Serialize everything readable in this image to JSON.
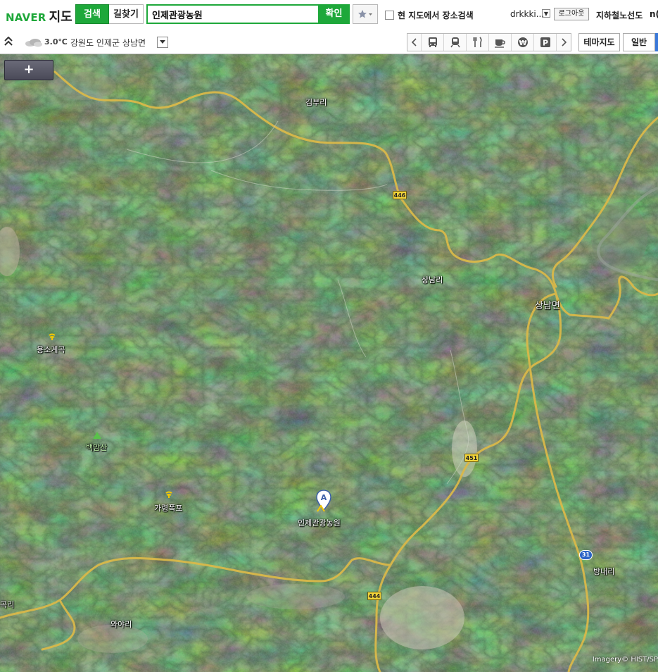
{
  "header": {
    "logo_brand": "NAVER",
    "logo_service": "지도",
    "tab_search": "검색",
    "tab_route": "길찾기",
    "search_value": "인제관광농원",
    "confirm_label": "확인",
    "checkbox_label": "현 지도에서 장소검색",
    "username": "drkkki...",
    "logout_label": "로그아웃",
    "subway_label": "지하철노선도",
    "extra_link": "n("
  },
  "subbar": {
    "temperature": "3.0℃",
    "location": "강원도 인제군 상남면",
    "theme_map_label": "테마지도",
    "general_label": "일반",
    "categories": [
      {
        "icon": "chevron-left-icon"
      },
      {
        "icon": "bus-icon"
      },
      {
        "icon": "subway-icon"
      },
      {
        "icon": "restaurant-icon"
      },
      {
        "icon": "cafe-icon"
      },
      {
        "icon": "bank-icon"
      },
      {
        "icon": "parking-icon"
      },
      {
        "icon": "chevron-right-icon"
      }
    ]
  },
  "map": {
    "zoom_in_label": "+",
    "labels": {
      "gimburi": "김부리",
      "sangnamri": "상남리",
      "sangnammyeon": "상남면",
      "yongsogyegok": "용소계곡",
      "baegamsan": "백암산",
      "garyeongpokpo": "가령폭포",
      "target": "인제관광농원",
      "bangnaeri": "방내리",
      "wayari": "와야리",
      "left_edge": "곡리"
    },
    "road_numbers": {
      "r446_top": "446",
      "r451": "451",
      "r444": "444",
      "r31": "31"
    },
    "marker_letter": "A",
    "copyright": "Imagery© HIST/SP"
  },
  "colors": {
    "naver_green": "#1ea83a",
    "road_yellow": "#d9b84a",
    "route_blue": "#2a63c6"
  }
}
